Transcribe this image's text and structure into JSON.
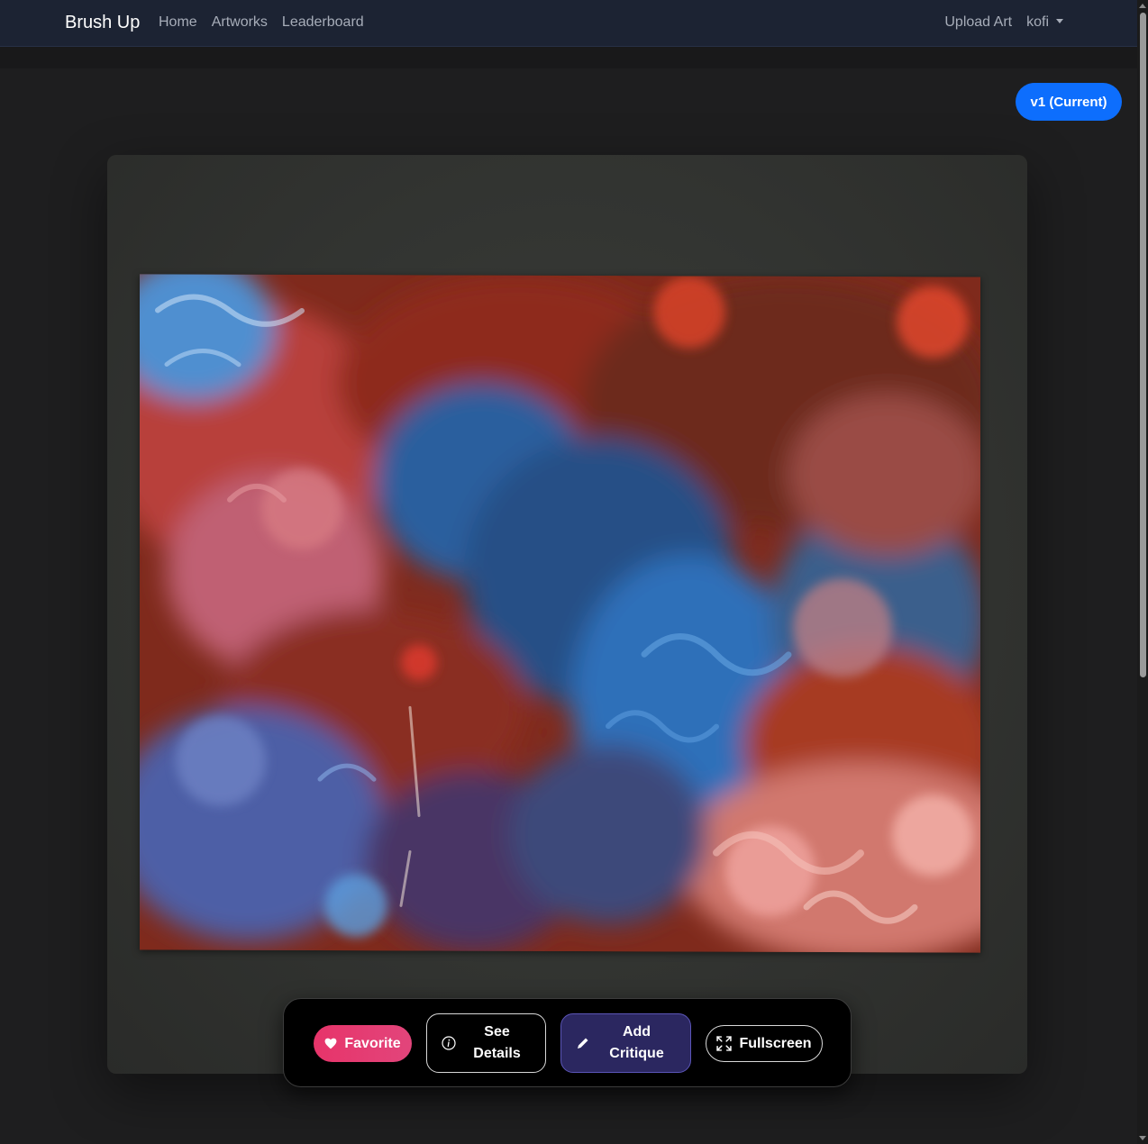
{
  "navbar": {
    "brand": "Brush Up",
    "links": [
      "Home",
      "Artworks",
      "Leaderboard"
    ],
    "upload_label": "Upload Art",
    "user_label": "kofi"
  },
  "version": {
    "label": "v1 (Current)"
  },
  "actions": {
    "favorite_label": "Favorite",
    "details_label": "See\nDetails",
    "critique_label": "Add\nCritique",
    "fullscreen_label": "Fullscreen"
  },
  "colors": {
    "navbar_bg": "#1c2333",
    "accent_blue": "#0d6efd",
    "favorite_pink": "#e7346a",
    "critique_purple": "#2b2760"
  },
  "icons": {
    "favorite": "heart-icon",
    "details": "info-icon",
    "critique": "pencil-icon",
    "fullscreen": "expand-icon"
  }
}
